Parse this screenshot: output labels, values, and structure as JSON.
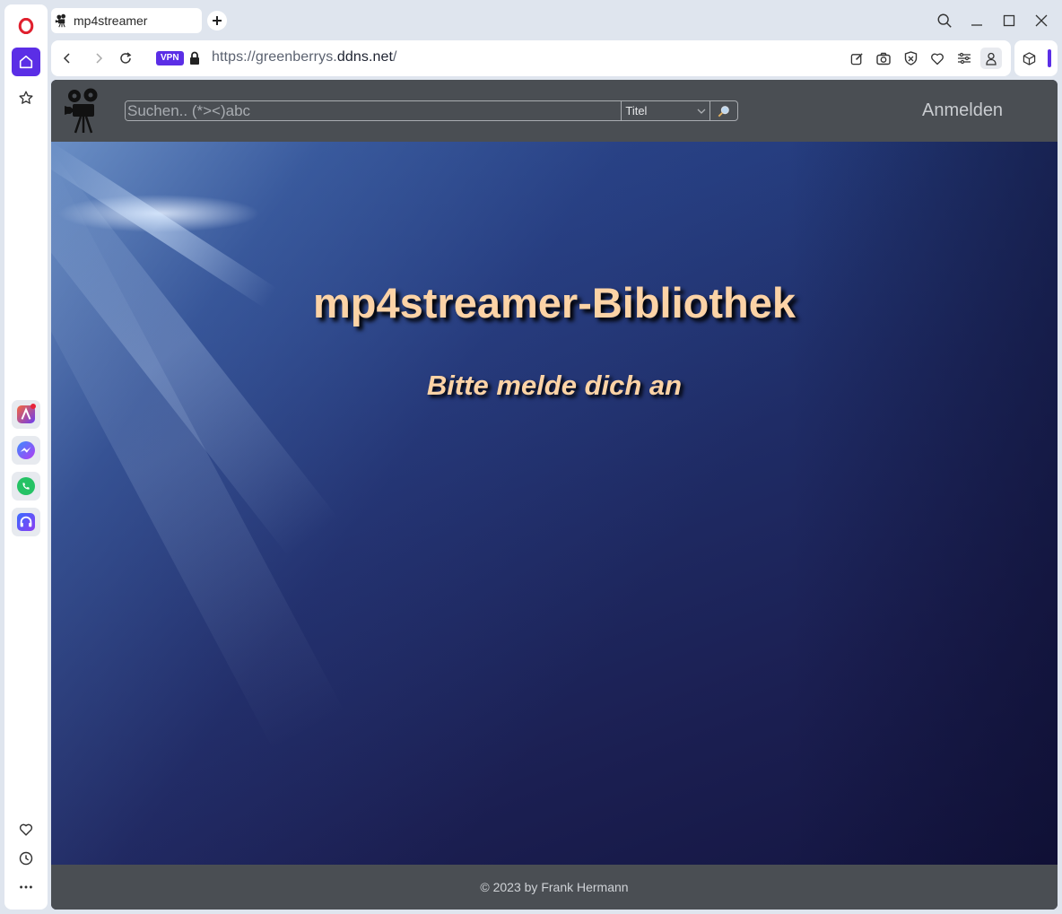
{
  "browser": {
    "tab_title": "mp4streamer",
    "url_prefix": "https://greenberrys.",
    "url_host": "ddns.net",
    "url_suffix": "/",
    "vpn_label": "VPN",
    "accent_color": "#5b2ee6"
  },
  "sidebar": {
    "top_icons": [
      "opera-logo-icon",
      "home-icon",
      "star-icon"
    ],
    "apps": [
      "aria-icon",
      "messenger-icon",
      "whatsapp-icon",
      "music-icon"
    ],
    "bottom_icons": [
      "heart-icon",
      "clock-icon",
      "more-icon"
    ]
  },
  "header": {
    "search_placeholder": "Suchen.. (*><)abc",
    "filter_selected": "Titel",
    "search_button_icon": "magnifier-icon",
    "login_label": "Anmelden"
  },
  "hero": {
    "title": "mp4streamer-Bibliothek",
    "subtitle": "Bitte melde dich an",
    "text_color": "#fcd3a6"
  },
  "footer": {
    "text": "© 2023 by Frank Hermann"
  }
}
